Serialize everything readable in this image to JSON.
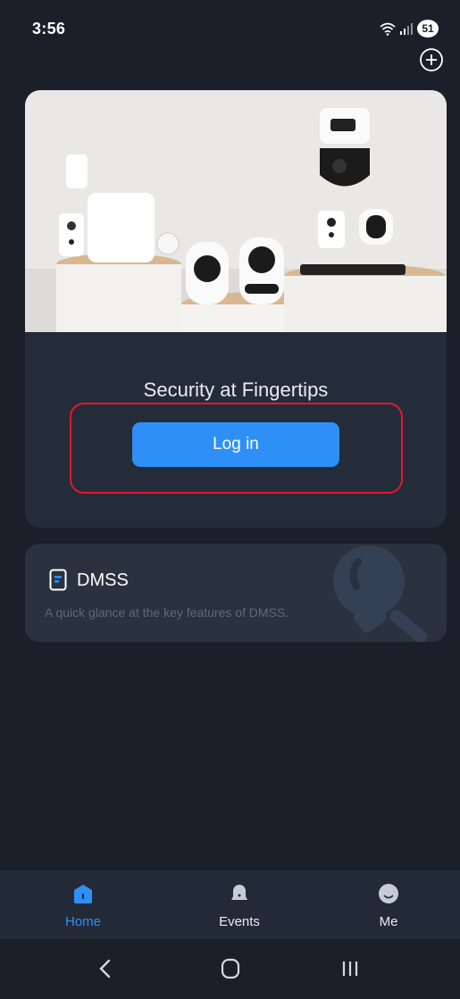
{
  "status_bar": {
    "time": "3:56",
    "battery": "51"
  },
  "hero": {
    "tagline": "Security at Fingertips",
    "login_label": "Log in"
  },
  "feature": {
    "title": "DMSS",
    "description": "A quick glance at the key features of DMSS."
  },
  "nav": {
    "items": [
      {
        "label": "Home",
        "icon": "home-icon",
        "active": true
      },
      {
        "label": "Events",
        "icon": "bell-icon",
        "active": false
      },
      {
        "label": "Me",
        "icon": "avatar-icon",
        "active": false
      }
    ]
  },
  "colors": {
    "background": "#1a1f2a",
    "card": "#252c39",
    "accent": "#2e90f7",
    "highlight": "#e3162c"
  }
}
